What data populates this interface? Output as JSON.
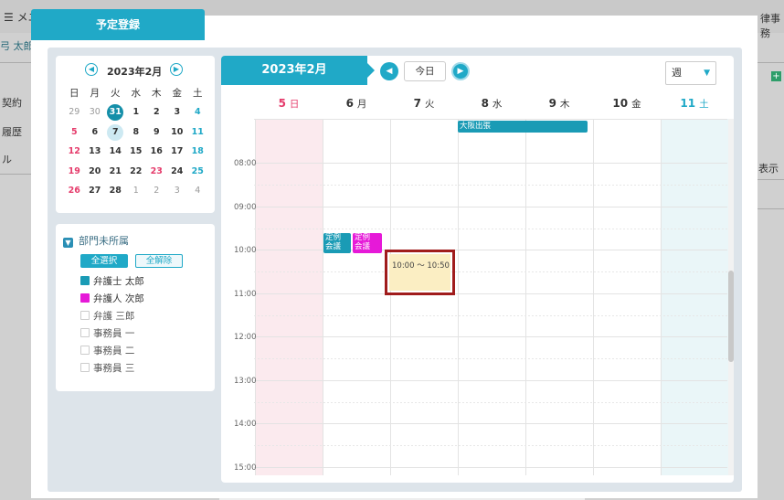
{
  "background": {
    "menu_label": "☰ メニ",
    "user_label": "弓 太郎",
    "side_items": [
      "契約",
      "履歴",
      "ル"
    ],
    "right_top": "律事務",
    "right_display": "表示"
  },
  "modal": {
    "tab_title": "予定登録"
  },
  "mini_calendar": {
    "title": "2023年2月",
    "prev_icon": "◀",
    "next_icon": "▶",
    "weekdays": [
      "日",
      "月",
      "火",
      "水",
      "木",
      "金",
      "土"
    ],
    "weeks": [
      [
        {
          "d": "29",
          "c": "gray"
        },
        {
          "d": "30",
          "c": "gray"
        },
        {
          "d": "31",
          "c": "today"
        },
        {
          "d": "1",
          "c": ""
        },
        {
          "d": "2",
          "c": ""
        },
        {
          "d": "3",
          "c": ""
        },
        {
          "d": "4",
          "c": "blue"
        }
      ],
      [
        {
          "d": "5",
          "c": "red"
        },
        {
          "d": "6",
          "c": ""
        },
        {
          "d": "7",
          "c": "sel"
        },
        {
          "d": "8",
          "c": ""
        },
        {
          "d": "9",
          "c": ""
        },
        {
          "d": "10",
          "c": ""
        },
        {
          "d": "11",
          "c": "blue"
        }
      ],
      [
        {
          "d": "12",
          "c": "red"
        },
        {
          "d": "13",
          "c": ""
        },
        {
          "d": "14",
          "c": ""
        },
        {
          "d": "15",
          "c": ""
        },
        {
          "d": "16",
          "c": ""
        },
        {
          "d": "17",
          "c": ""
        },
        {
          "d": "18",
          "c": "blue"
        }
      ],
      [
        {
          "d": "19",
          "c": "red"
        },
        {
          "d": "20",
          "c": ""
        },
        {
          "d": "21",
          "c": ""
        },
        {
          "d": "22",
          "c": ""
        },
        {
          "d": "23",
          "c": "red"
        },
        {
          "d": "24",
          "c": ""
        },
        {
          "d": "25",
          "c": "blue"
        }
      ],
      [
        {
          "d": "26",
          "c": "red"
        },
        {
          "d": "27",
          "c": ""
        },
        {
          "d": "28",
          "c": ""
        },
        {
          "d": "1",
          "c": "gray"
        },
        {
          "d": "2",
          "c": "gray"
        },
        {
          "d": "3",
          "c": "gray"
        },
        {
          "d": "4",
          "c": "gray"
        }
      ]
    ]
  },
  "department": {
    "title": "部門未所属",
    "select_all": "全選択",
    "deselect_all": "全解除",
    "members": [
      {
        "name": "弁護士 太郎",
        "color": "#1a9bb5",
        "checked": true
      },
      {
        "name": "弁護人 次郎",
        "color": "#e619d8",
        "checked": true
      },
      {
        "name": "弁護 三郎",
        "color": "",
        "checked": false
      },
      {
        "name": "事務員 一",
        "color": "",
        "checked": false
      },
      {
        "name": "事務員 二",
        "color": "",
        "checked": false
      },
      {
        "name": "事務員 三",
        "color": "",
        "checked": false
      }
    ]
  },
  "week_view": {
    "title": "2023年2月",
    "prev_icon": "◀",
    "next_icon": "▶",
    "today_label": "今日",
    "view_select": "週",
    "view_select_arrow": "▼",
    "days": [
      {
        "num": "5",
        "wd": "日",
        "type": "sun"
      },
      {
        "num": "6",
        "wd": "月",
        "type": ""
      },
      {
        "num": "7",
        "wd": "火",
        "type": ""
      },
      {
        "num": "8",
        "wd": "水",
        "type": ""
      },
      {
        "num": "9",
        "wd": "木",
        "type": ""
      },
      {
        "num": "10",
        "wd": "金",
        "type": ""
      },
      {
        "num": "11",
        "wd": "土",
        "type": "sat"
      }
    ],
    "time_labels": [
      "08:00",
      "09:00",
      "10:00",
      "11:00",
      "12:00",
      "13:00",
      "14:00",
      "15:00"
    ],
    "events": {
      "osaka_trip": "大阪出張",
      "meeting_1_line1": "定例",
      "meeting_1_line2": "会議",
      "meeting_2_line1": "定例",
      "meeting_2_line2": "会議",
      "new_event_time": "10:00 〜 10:50"
    },
    "colors": {
      "teal": "#1a9bb5",
      "magenta": "#e619d8",
      "new_event": "#fbeec3",
      "highlight_border": "#a01c1c"
    }
  }
}
